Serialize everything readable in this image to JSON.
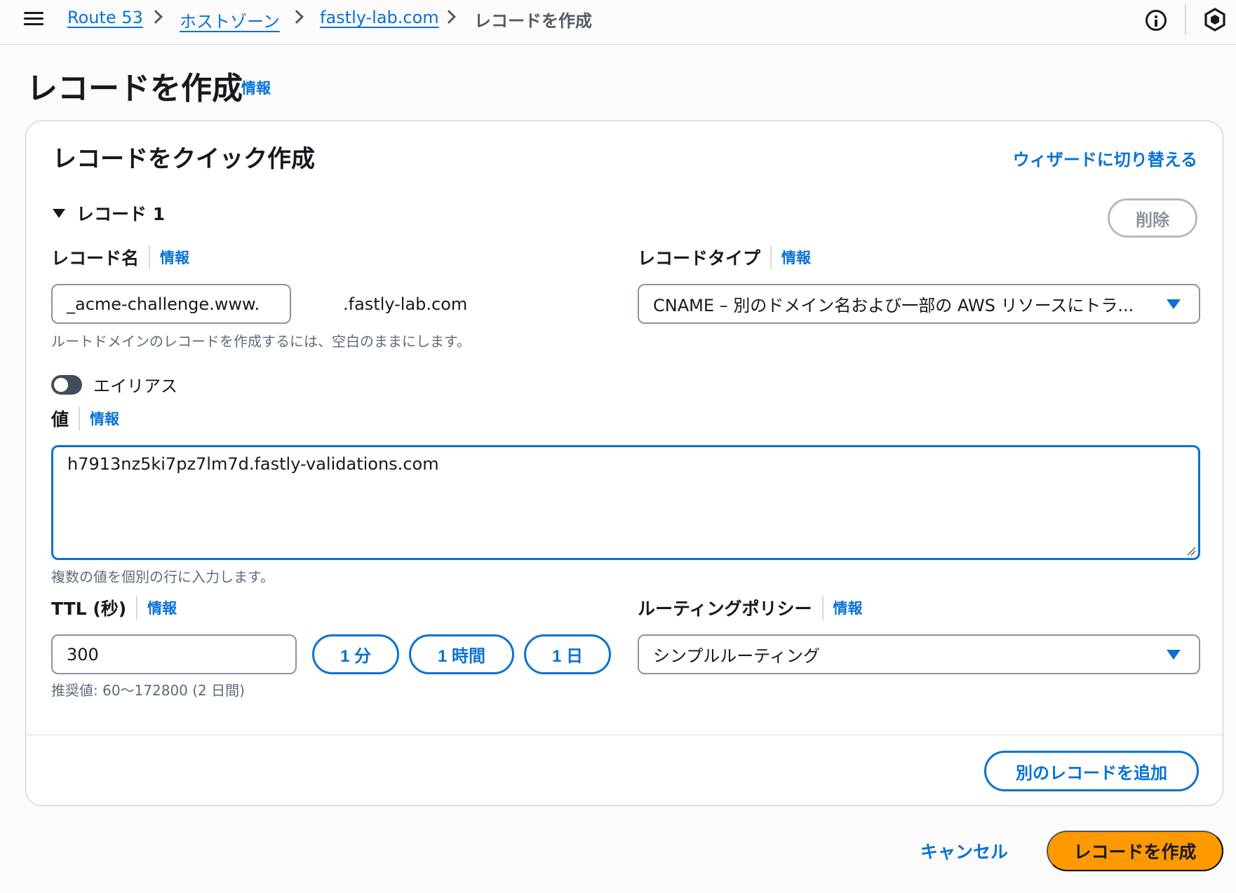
{
  "breadcrumb": {
    "items": [
      "Route 53",
      "ホストゾーン",
      "fastly-lab.com"
    ],
    "current": "レコードを作成"
  },
  "page": {
    "title": "レコードを作成",
    "info_label": "情報"
  },
  "section": {
    "title": "レコードをクイック作成",
    "wizard_link": "ウィザードに切り替える"
  },
  "record": {
    "header": "レコード 1",
    "delete_label": "削除",
    "name": {
      "label": "レコード名",
      "info": "情報",
      "value": "_acme-challenge.www.",
      "suffix": ".fastly-lab.com",
      "help": "ルートドメインのレコードを作成するには、空白のままにします。"
    },
    "type": {
      "label": "レコードタイプ",
      "info": "情報",
      "selected": "CNAME – 別のドメイン名および一部の AWS リソースにトラ..."
    },
    "alias": {
      "label": "エイリアス",
      "enabled": false
    },
    "value": {
      "label": "値",
      "info": "情報",
      "text": "h7913nz5ki7pz7lm7d.fastly-validations.com",
      "help": "複数の値を個別の行に入力します。"
    },
    "ttl": {
      "label": "TTL (秒)",
      "info": "情報",
      "value": "300",
      "help": "推奨値: 60〜172800 (2 日間)",
      "presets": [
        "1 分",
        "1 時間",
        "1 日"
      ]
    },
    "routing": {
      "label": "ルーティングポリシー",
      "info": "情報",
      "selected": "シンプルルーティング"
    }
  },
  "add_record_label": "別のレコードを追加",
  "actions": {
    "cancel": "キャンセル",
    "create": "レコードを作成"
  },
  "colors": {
    "link": "#0972d3",
    "primary": "#ff9900",
    "text": "#16191f",
    "muted": "#5f6b7a"
  }
}
